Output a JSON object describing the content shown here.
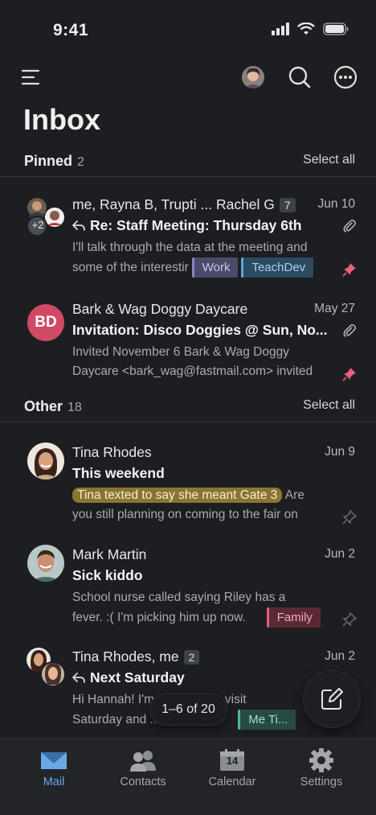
{
  "status": {
    "time": "9:41"
  },
  "page_title": "Inbox",
  "pinned": {
    "label": "Pinned",
    "count": "2",
    "select_all": "Select all",
    "messages": [
      {
        "from": "me, Rayna B, Trupti ... Rachel G",
        "thread_count": "7",
        "date": "Jun 10",
        "subject": "Re: Staff Meeting: Thursday 6th",
        "preview_line1": "I'll talk through the data at the meeting and",
        "preview_line2": "some of the interestir",
        "labels": [
          "Work",
          "TeachDev"
        ],
        "avatar_extra": "+2"
      },
      {
        "from": "Bark & Wag Doggy Daycare",
        "date": "May 27",
        "subject": "Invitation: Disco Doggies @ Sun, No...",
        "preview_line1": "Invited November 6 Bark & Wag Doggy",
        "preview_line2": "Daycare <bark_wag@fastmail.com> invited",
        "avatar_initials": "BD"
      }
    ]
  },
  "other": {
    "label": "Other",
    "count": "18",
    "select_all": "Select all",
    "messages": [
      {
        "from": "Tina Rhodes",
        "date": "Jun 9",
        "subject": "This weekend",
        "highlight": "Tina texted to say she meant Gate 3",
        "preview_rest": " Are",
        "preview_line2": "you still planning on coming to the fair on"
      },
      {
        "from": "Mark Martin",
        "date": "Jun 2",
        "subject": "Sick kiddo",
        "preview_line1": "School nurse called saying Riley has a",
        "preview_line2": "fever. :( I'm picking him up now.",
        "labels": [
          "Family"
        ]
      },
      {
        "from": "Tina Rhodes, me",
        "thread_count": "2",
        "date": "Jun 2",
        "subject": "Next Saturday",
        "preview_line1": "Hi Hannah! I'm ... a college visit",
        "preview_line2": "Saturday and ... ack in",
        "labels": [
          "Me Ti..."
        ]
      }
    ]
  },
  "pager": "1–6 of 20",
  "tabs": [
    {
      "label": "Mail",
      "icon": "mail-icon",
      "active": true
    },
    {
      "label": "Contacts",
      "icon": "contacts-icon"
    },
    {
      "label": "Calendar",
      "icon": "calendar-icon",
      "day": "14"
    },
    {
      "label": "Settings",
      "icon": "settings-icon"
    }
  ],
  "colors": {
    "accent": "#6ba8e6",
    "background": "#1c1e22",
    "pin": "#e8607e"
  }
}
